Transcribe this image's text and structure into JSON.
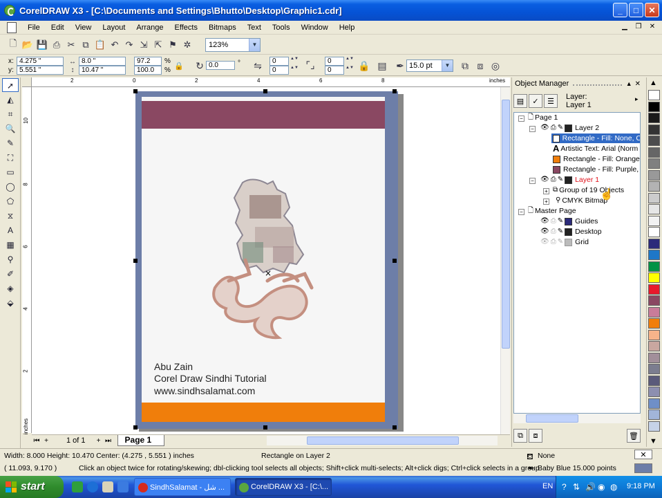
{
  "window": {
    "title": "CorelDRAW X3 - [C:\\Documents and Settings\\Bhutto\\Desktop\\Graphic1.cdr]",
    "minimize": "_",
    "maximize": "□",
    "close": "✕"
  },
  "menu": {
    "items": [
      "File",
      "Edit",
      "View",
      "Layout",
      "Arrange",
      "Effects",
      "Bitmaps",
      "Text",
      "Tools",
      "Window",
      "Help"
    ]
  },
  "toolbar": {
    "zoom": "123%"
  },
  "property_bar": {
    "x_label": "x:",
    "x_value": "4.275 \"",
    "y_label": "y:",
    "y_value": "5.551 \"",
    "width_value": "8.0 \"",
    "height_value": "10.47 \"",
    "scale_w": "97.2",
    "scale_h": "100.0",
    "pct": "%",
    "angle": "0.0",
    "corner1": "0",
    "corner2": "0",
    "corner3": "0",
    "corner4": "0",
    "outline_width": "15.0 pt"
  },
  "ruler": {
    "top_labels": [
      "2",
      "0",
      "2",
      "4",
      "6",
      "8"
    ],
    "unit": "inches",
    "left_labels": [
      "10",
      "8",
      "6",
      "4",
      "2"
    ],
    "left_unit": "inches"
  },
  "document": {
    "line1": "Abu Zain",
    "line2": "Corel Draw Sindhi Tutorial",
    "line3": "www.sindhsalamat.com",
    "colors": {
      "page_border": "#6d7ea8",
      "top_band": "#8a4862",
      "bottom_band": "#f07e0b"
    }
  },
  "page_nav": {
    "count": "1 of 1",
    "tab": "Page 1"
  },
  "object_manager": {
    "title": "Object Manager",
    "layer_heading": "Layer:",
    "layer_name": "Layer 1",
    "tree": {
      "page1": "Page 1",
      "layer2": "Layer 2",
      "rect_none": "Rectangle - Fill: None, C",
      "artistic_text": "Artistic Text: Arial (Norm",
      "rect_orange": "Rectangle - Fill: Orange,",
      "rect_purple": "Rectangle - Fill: Purple, C",
      "layer1": "Layer 1",
      "group": "Group of 19 Objects",
      "bitmap": "CMYK Bitmap",
      "master": "Master Page",
      "guides": "Guides",
      "desktop": "Desktop",
      "grid": "Grid"
    }
  },
  "palette": {
    "colors": [
      "#ffffff",
      "#000000",
      "#1a1a1a",
      "#333333",
      "#4d4d4d",
      "#666666",
      "#808080",
      "#999999",
      "#b3b3b3",
      "#cccccc",
      "#e6e6e6",
      "#f2f2f2",
      "#ffffff",
      "#2b2a7a",
      "#1f77c7",
      "#009245",
      "#ffff00",
      "#e8192c",
      "#8a4862",
      "#c97c9a",
      "#f07e0b",
      "#f7b38a",
      "#c9a7a0",
      "#a28f9a",
      "#7b7d8f",
      "#5a5a7a",
      "#8d8fb0",
      "#6f8fc7",
      "#a2b5d9",
      "#c6d3e8"
    ]
  },
  "status": {
    "dims": "Width: 8.000  Height: 10.470  Center: (4.275 , 5.551 )  inches",
    "object": "Rectangle on Layer 2",
    "fill": "None",
    "coords": "( 11.093, 9.170 )",
    "hint": "Click an object twice for rotating/skewing; dbl-clicking tool selects all objects; Shift+click multi-selects; Alt+click digs; Ctrl+click selects in a group",
    "outline": "Baby Blue  15.000 points"
  },
  "taskbar": {
    "start": "start",
    "task1": "SindhSalamat - شل ...",
    "task2": "CorelDRAW X3 - [C:\\...",
    "lang": "EN",
    "time": "9:18 PM"
  }
}
